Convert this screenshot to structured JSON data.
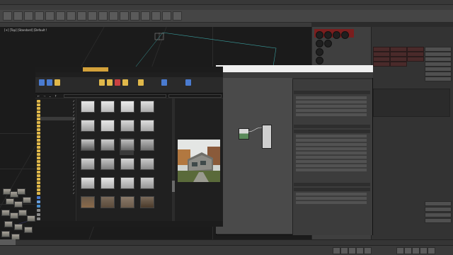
{
  "app": {
    "title": "",
    "menu": [
      "",
      "",
      "",
      "",
      "",
      "",
      "",
      "",
      "",
      "",
      "",
      "",
      "",
      "",
      ""
    ]
  },
  "viewport": {
    "label": "[+] [Top] [Standard] [Default Shading]"
  },
  "explorer": {
    "context_tab": "",
    "tabs": [
      "",
      "",
      "",
      ""
    ],
    "ribbon_groups": [
      "",
      "",
      "",
      "",
      ""
    ],
    "address": "",
    "search_placeholder": "",
    "nav_items": [
      "",
      "",
      "",
      "",
      "",
      "",
      "",
      "",
      "",
      "",
      "",
      "",
      "",
      "",
      "",
      "",
      "",
      "",
      "",
      "",
      "",
      "",
      "",
      "",
      "",
      "",
      "",
      "",
      "",
      "",
      "",
      "",
      ""
    ],
    "files": [
      "",
      "",
      "",
      "",
      "",
      "",
      "",
      "",
      "",
      "",
      "",
      "",
      "",
      "",
      "",
      "",
      "",
      "",
      "",
      "",
      "",
      "",
      "",
      "",
      "",
      "",
      "",
      ""
    ],
    "status": ""
  },
  "slate": {
    "title": "",
    "menu": [
      "",
      "",
      "",
      "",
      "",
      ""
    ],
    "param_sections": [
      "",
      "",
      "",
      "",
      ""
    ]
  },
  "command_panel": {
    "tabs": [
      "",
      "",
      ""
    ],
    "buttons": [
      "",
      "",
      "",
      "",
      "",
      "",
      "",
      "",
      ""
    ]
  },
  "statusbar": {
    "frame": "",
    "prompt": ""
  },
  "colors": {
    "accent": "#d3a13a",
    "panel": "#3f3f3f",
    "viewport_bg": "#1b1b1b",
    "explorer_bg": "#202020",
    "folder": "#e0b84a",
    "button_red": "#7a1e1e"
  }
}
